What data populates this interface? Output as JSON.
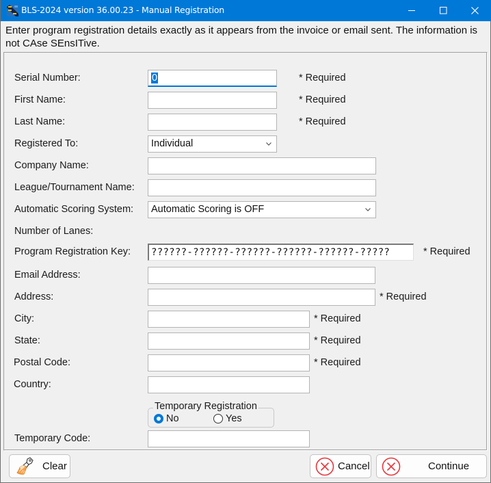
{
  "window": {
    "title": "BLS-2024 version 36.00.23  -  Manual Registration",
    "app_icon": "bls-app-icon",
    "controls": {
      "minimize": "minimize-icon",
      "maximize": "maximize-icon",
      "close": "close-icon"
    }
  },
  "intro_text": "Enter program registration details exactly as it appears from the invoice or email sent. The information is not CAse SEnsITive.",
  "required_label": "* Required",
  "form": {
    "serial_number": {
      "label": "Serial Number:",
      "value": "0",
      "required": true
    },
    "first_name": {
      "label": "First Name:",
      "value": "",
      "required": true
    },
    "last_name": {
      "label": "Last Name:",
      "value": "",
      "required": true
    },
    "registered_to": {
      "label": "Registered To:",
      "value": "Individual"
    },
    "company_name": {
      "label": "Company Name:",
      "value": ""
    },
    "league_name": {
      "label": "League/Tournament Name:",
      "value": ""
    },
    "scoring_system": {
      "label": "Automatic Scoring System:",
      "value": "Automatic Scoring is OFF"
    },
    "number_of_lanes": {
      "label": "Number of Lanes:"
    },
    "registration_key": {
      "label": "Program Registration Key:",
      "value": "??????-??????-??????-??????-??????-?????",
      "required": true
    },
    "email": {
      "label": "Email Address:",
      "value": ""
    },
    "address": {
      "label": "Address:",
      "value": "",
      "required": true
    },
    "city": {
      "label": "City:",
      "value": "",
      "required": true
    },
    "state": {
      "label": "State:",
      "value": "",
      "required": true
    },
    "postal_code": {
      "label": "Postal Code:",
      "value": "",
      "required": true
    },
    "country": {
      "label": "Country:",
      "value": ""
    },
    "temporary_registration": {
      "legend": "Temporary Registration",
      "options": [
        {
          "label": "No",
          "selected": true
        },
        {
          "label": "Yes",
          "selected": false
        }
      ]
    },
    "temporary_code": {
      "label": "Temporary Code:",
      "value": ""
    }
  },
  "buttons": {
    "clear": {
      "label": "Clear",
      "icon": "broom-icon"
    },
    "cancel": {
      "label": "Cancel",
      "icon": "cancel-x-icon"
    },
    "continue": {
      "label": "Continue",
      "icon": "cancel-x-icon"
    }
  },
  "colors": {
    "titlebar": "#0078d7",
    "accent": "#0078d7",
    "icon_red": "#e8363c",
    "broom_orange": "#f7a04a"
  }
}
